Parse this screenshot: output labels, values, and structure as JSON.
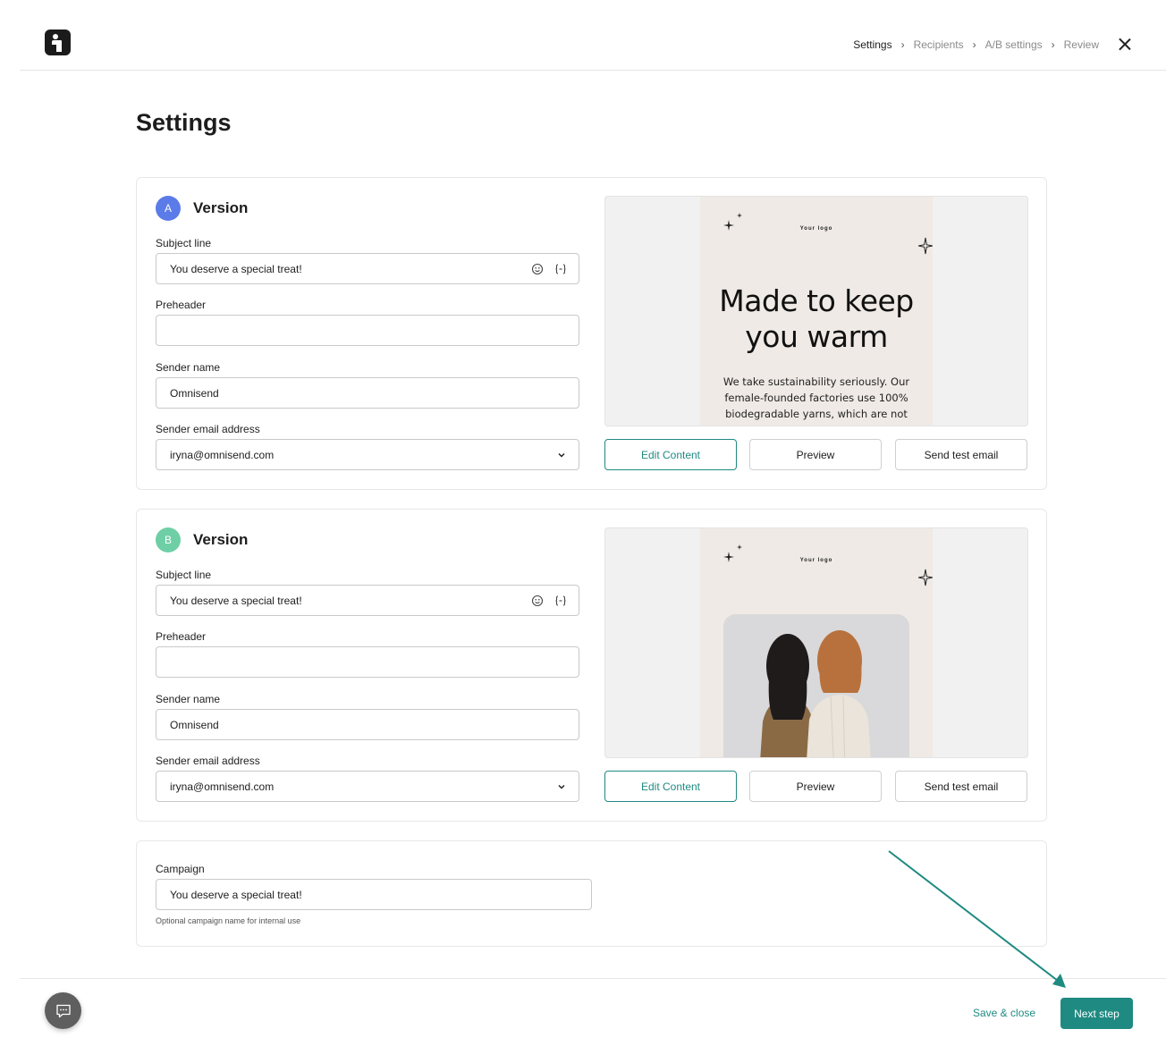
{
  "header": {
    "steps": [
      "Settings",
      "Recipients",
      "A/B settings",
      "Review"
    ],
    "active_step": "Settings"
  },
  "page": {
    "title": "Settings"
  },
  "labels": {
    "subject_line": "Subject line",
    "preheader": "Preheader",
    "sender_name": "Sender name",
    "sender_email": "Sender email address",
    "campaign": "Campaign"
  },
  "versions": [
    {
      "badge": "A",
      "title": "Version",
      "subject_line": "You deserve a special treat!",
      "preheader": "",
      "sender_name": "Omnisend",
      "sender_email": "iryna@omnisend.com",
      "preview": {
        "logo_text": "Your logo",
        "heading_line1": "Made to keep",
        "heading_line2": "you warm",
        "body_lines": [
          "We take sustainability seriously. Our",
          "female-founded factories use 100%",
          "biodegradable yarns, which are not"
        ]
      }
    },
    {
      "badge": "B",
      "title": "Version",
      "subject_line": "You deserve a special treat!",
      "preheader": "",
      "sender_name": "Omnisend",
      "sender_email": "iryna@omnisend.com",
      "preview": {
        "logo_text": "Your logo"
      }
    }
  ],
  "buttons": {
    "edit_content": "Edit Content",
    "preview": "Preview",
    "send_test_email": "Send test email"
  },
  "campaign": {
    "value": "You deserve a special treat!",
    "hint": "Optional campaign name for internal use"
  },
  "footer": {
    "save_close": "Save & close",
    "next_step": "Next step"
  },
  "colors": {
    "accent": "#1f8a82",
    "badge_a": "#5b7be8",
    "badge_b": "#6ecfa6"
  }
}
